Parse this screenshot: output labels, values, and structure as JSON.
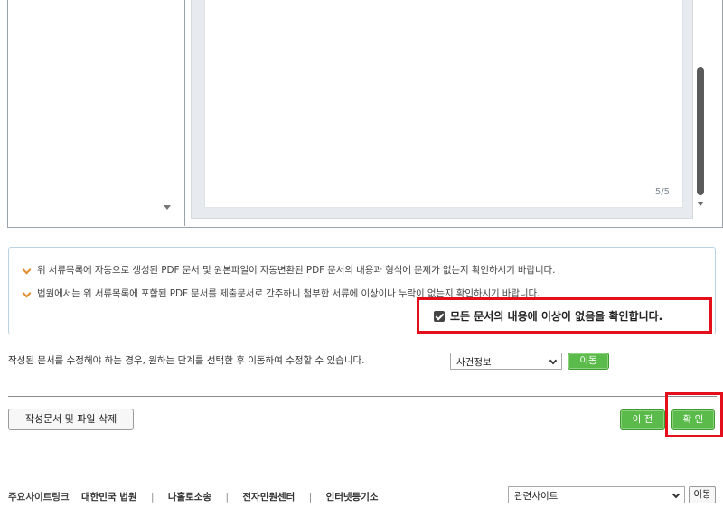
{
  "viewer": {
    "page_indicator": "5/5"
  },
  "notice": {
    "line1": "위 서류목록에 자동으로 생성된 PDF 문서 및 원본파일이 자동변환된 PDF 문서의 내용과 형식에 문제가 없는지 확인하시기 바랍니다.",
    "line2": "법원에서는 위 서류목록에 포함된 PDF 문서를 제출문서로 간주하니 첨부한 서류에 이상이나 누락이 없는지 확인하시기 바랍니다.",
    "confirm_label": "모든 문서의 내용에 이상이 없음을 확인합니다.",
    "confirm_checked": true
  },
  "move": {
    "text": "작성된 문서를 수정해야 하는 경우, 원하는 단계를 선택한 후 이동하여 수정할 수 있습니다.",
    "select_value": "사건정보",
    "button": "이동"
  },
  "actions": {
    "delete_button": "작성문서 및 파일 삭제",
    "prev_button": "이 전",
    "ok_button": "확 인"
  },
  "footer": {
    "lead": "주요사이트링크",
    "links": [
      "대한민국 법원",
      "나홀로소송",
      "전자민원센터",
      "인터넷등기소"
    ],
    "site_select": "관련사이트",
    "site_button": "이동"
  },
  "colors": {
    "accent_green": "#5aba4a",
    "highlight_red": "#e3101c",
    "bullet_orange": "#e08c2a"
  }
}
